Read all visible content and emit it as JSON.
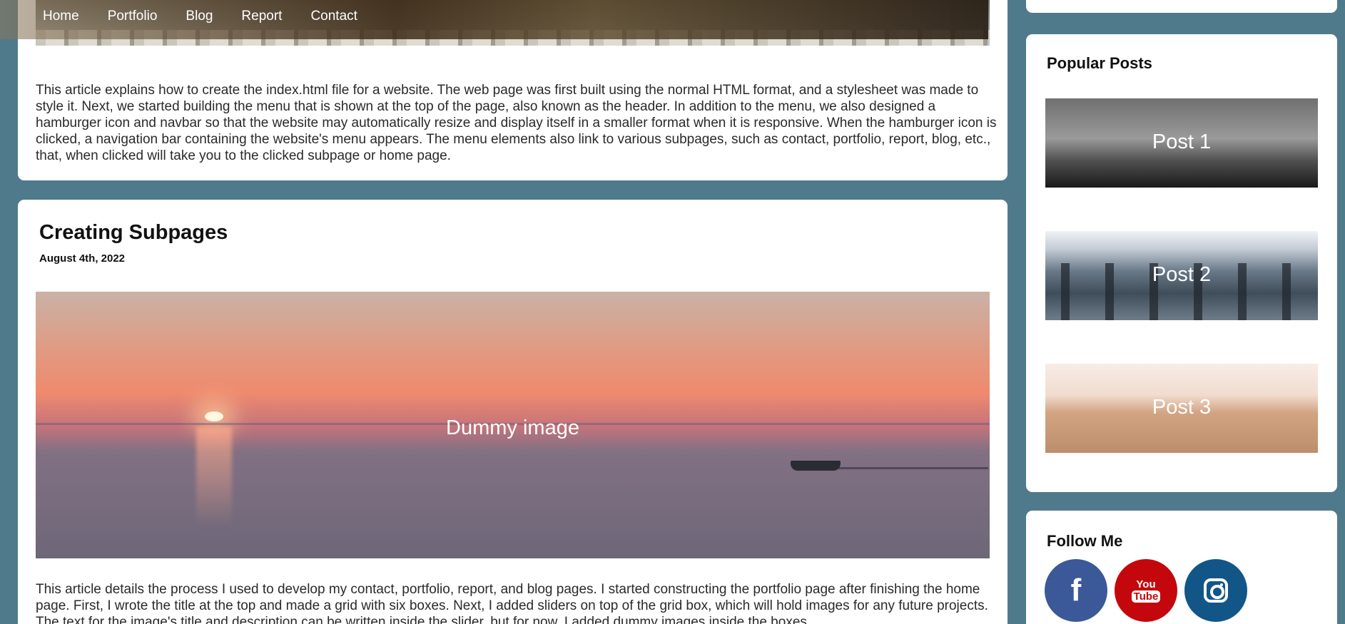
{
  "nav": {
    "items": [
      {
        "label": "Home"
      },
      {
        "label": "Portfolio"
      },
      {
        "label": "Blog"
      },
      {
        "label": "Report"
      },
      {
        "label": "Contact"
      }
    ]
  },
  "posts": [
    {
      "body": "This article explains how to create the index.html file for a website. The web page was first built using the normal HTML format, and a stylesheet was made to style it. Next, we started building the menu that is shown at the top of the page, also known as the header. In addition to the menu, we also designed a hamburger icon and navbar so that the website may automatically resize and display itself in a smaller format when it is responsive. When the hamburger icon is clicked, a navigation bar containing the website's menu appears. The menu elements also link to various subpages, such as contact, portfolio, report, blog, etc., that, when clicked will take you to the clicked subpage or home page."
    },
    {
      "title": "Creating Subpages",
      "date": "August 4th, 2022",
      "image_label": "Dummy image",
      "body": "This article details the process I used to develop my contact, portfolio, report, and blog pages. I started constructing the portfolio page after finishing the home page. First, I wrote the title at the top and made a grid with six boxes. Next, I added sliders on top of the grid box, which will hold images for any future projects. The text for the image's title and description can be written inside the slider, but for now, I added dummy images inside the boxes."
    }
  ],
  "sidebar": {
    "popular": {
      "heading": "Popular Posts",
      "items": [
        {
          "label": "Post 1"
        },
        {
          "label": "Post 2"
        },
        {
          "label": "Post 3"
        }
      ]
    },
    "follow": {
      "heading": "Follow Me",
      "socials": [
        {
          "icon": "facebook-icon",
          "glyph": "f",
          "color": "#3b5998"
        },
        {
          "icon": "youtube-icon",
          "you": "You",
          "tube": "Tube",
          "color": "#c4070d"
        },
        {
          "icon": "instagram-icon",
          "color": "#125688"
        }
      ]
    }
  }
}
